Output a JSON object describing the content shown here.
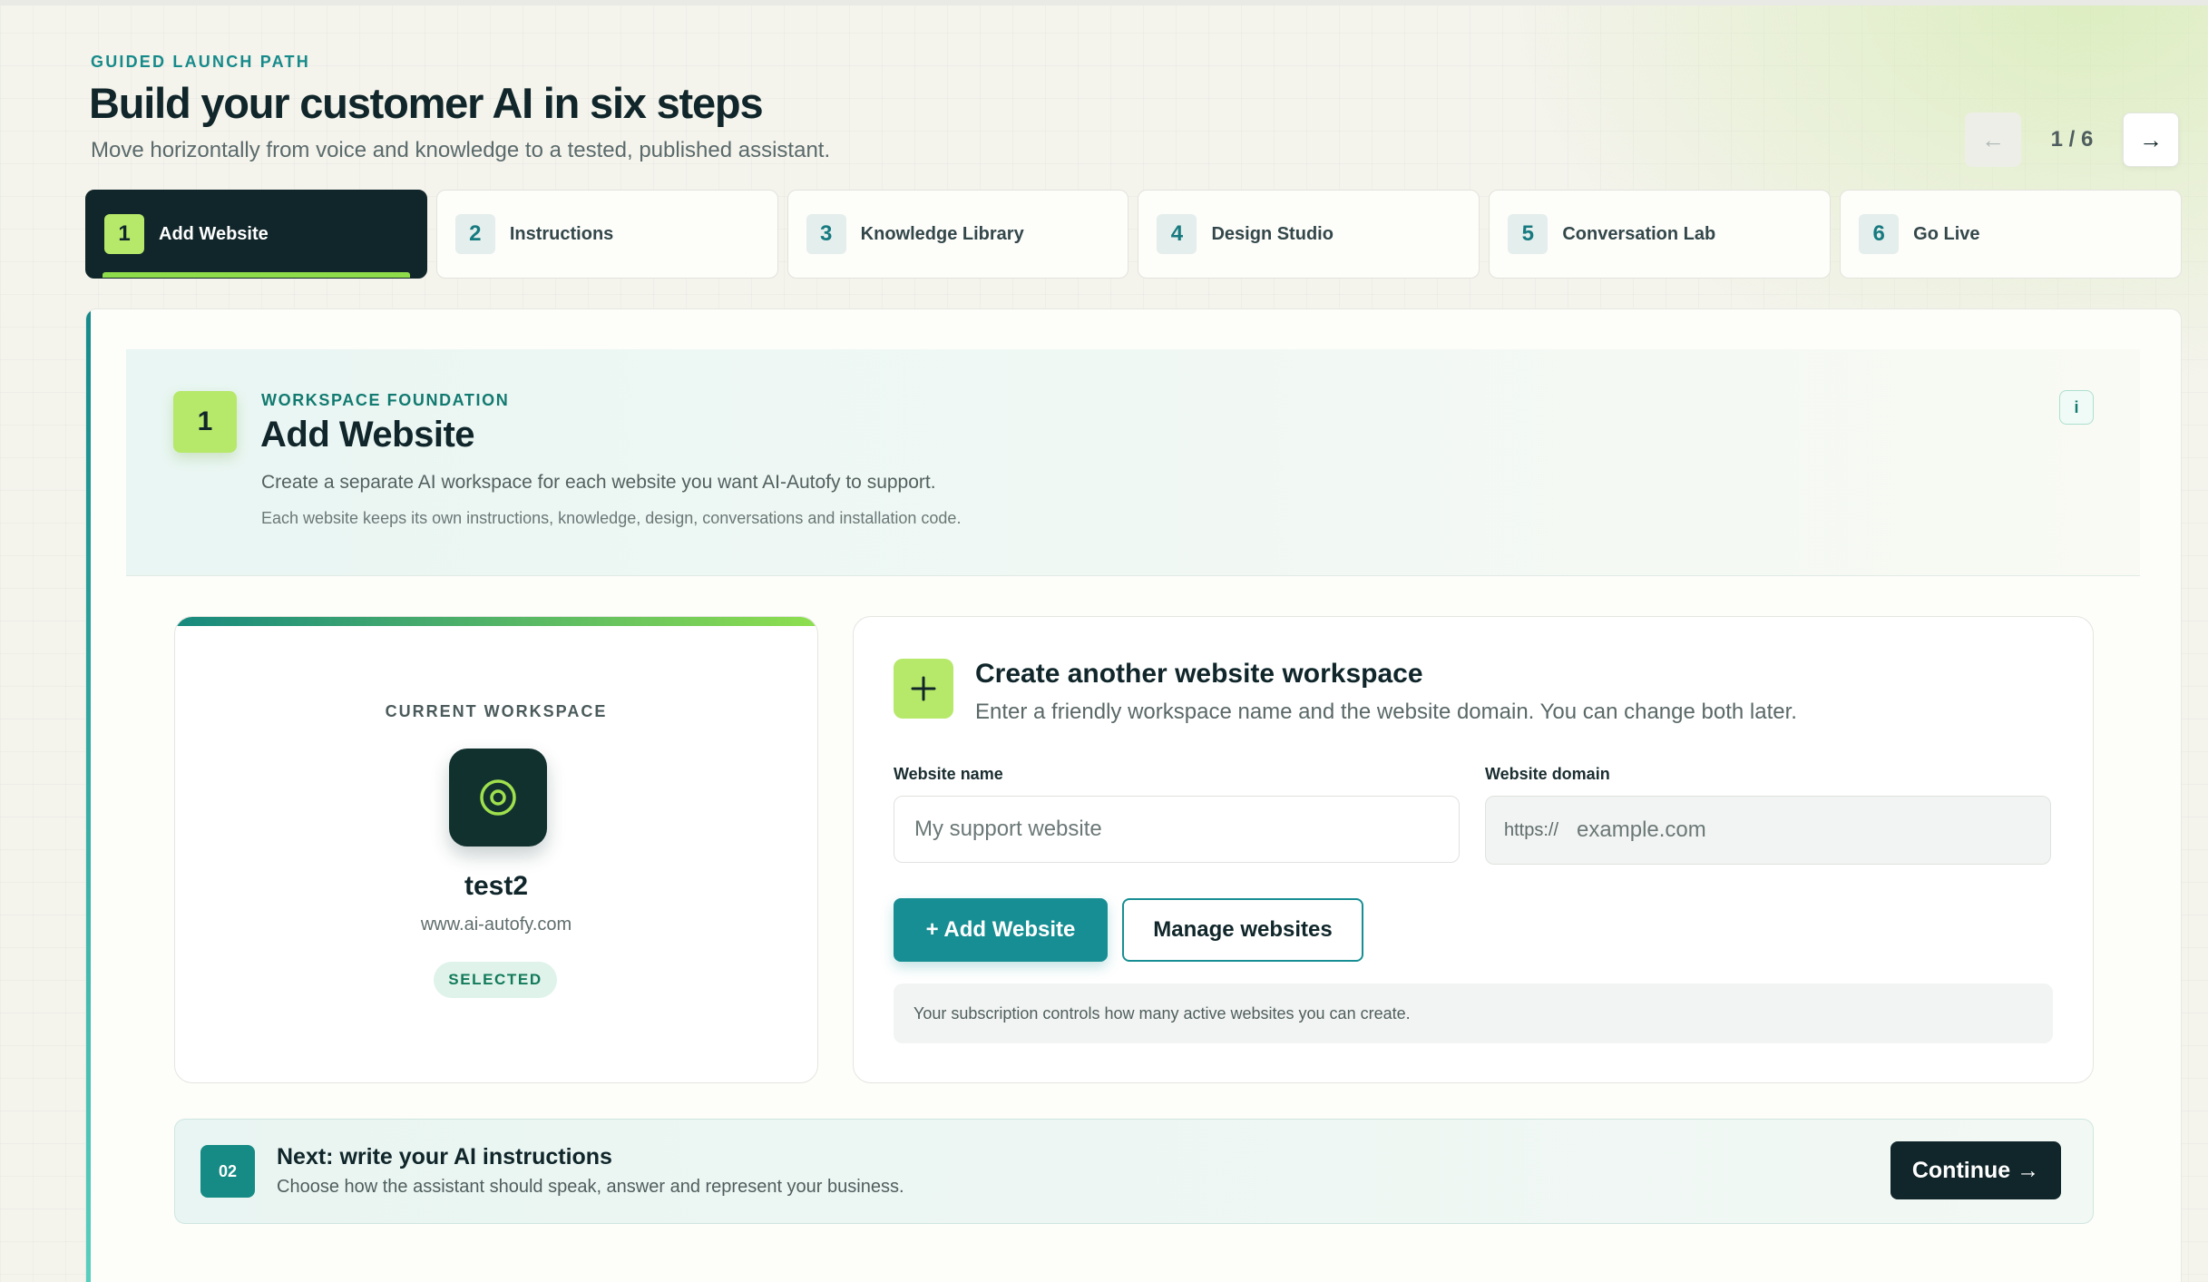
{
  "header": {
    "eyebrow": "GUIDED LAUNCH PATH",
    "title": "Build your customer AI in six steps",
    "subtitle": "Move horizontally from voice and knowledge to a tested, published assistant.",
    "pager": {
      "prev_icon": "←",
      "count": "1 / 6",
      "next_icon": "→"
    }
  },
  "steps": [
    {
      "num": "1",
      "label": "Add Website",
      "active": true
    },
    {
      "num": "2",
      "label": "Instructions"
    },
    {
      "num": "3",
      "label": "Knowledge Library"
    },
    {
      "num": "4",
      "label": "Design Studio"
    },
    {
      "num": "5",
      "label": "Conversation Lab"
    },
    {
      "num": "6",
      "label": "Go Live"
    }
  ],
  "intro": {
    "badge": "1",
    "eyebrow": "WORKSPACE FOUNDATION",
    "title": "Add Website",
    "description": "Create a separate AI workspace for each website you want AI-Autofy to support.",
    "note": "Each website keeps its own instructions, knowledge, design, conversations and installation code.",
    "info_icon": "i"
  },
  "workspace": {
    "label": "CURRENT WORKSPACE",
    "name": "test2",
    "domain": "www.ai-autofy.com",
    "badge": "SELECTED",
    "logo_icon": "target-icon"
  },
  "create": {
    "title": "Create another website workspace",
    "subtitle": "Enter a friendly workspace name and the website domain. You can change both later.",
    "name_label": "Website name",
    "name_placeholder": "My support website",
    "domain_label": "Website domain",
    "domain_prefix": "https://",
    "domain_placeholder": "example.com",
    "add_button": "+ Add Website",
    "manage_button": "Manage websites",
    "note": "Your subscription controls how many active websites you can create."
  },
  "next": {
    "badge": "02",
    "title": "Next: write your AI instructions",
    "subtitle": "Choose how the assistant should speak, answer and represent your business.",
    "continue_button": "Continue →"
  },
  "colors": {
    "dark": "#11262a",
    "teal": "#178e93",
    "lime": "#b6e86a"
  }
}
